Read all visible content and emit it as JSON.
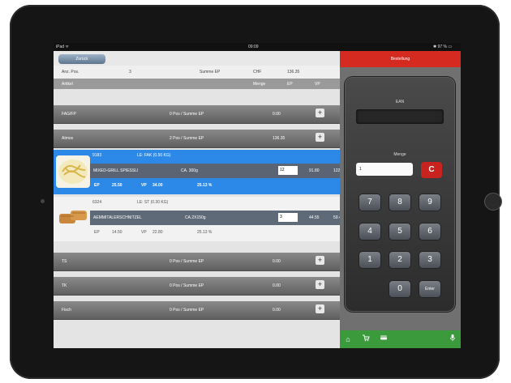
{
  "statusbar": {
    "carrier": "iPad ᯤ",
    "time": "09:09",
    "battery": "✱ 97 % ▭"
  },
  "header": {
    "back_label": "Zurück",
    "order_title": "Bestellung"
  },
  "info": {
    "pos_label": "Anz. Pos.",
    "pos_value": "3",
    "sum_label": "Summe EP",
    "currency": "CHF",
    "sum_value": "136.35"
  },
  "columns": {
    "article": "Artikel",
    "qty": "Menge",
    "ep": "EP",
    "vp": "VP"
  },
  "groups": [
    {
      "name": "FAG/FP",
      "summary": "0 Pos / Summe EP",
      "value": "0.00"
    },
    {
      "name": "Atmos",
      "summary": "2 Pos / Summe EP",
      "value": "136.35"
    },
    {
      "name": "TS",
      "summary": "0 Pos / Summe EP",
      "value": "0.00"
    },
    {
      "name": "TK",
      "summary": "0 Pos / Summe EP",
      "value": "0.00"
    },
    {
      "name": "Fisch",
      "summary": "0 Pos / Summe EP",
      "value": "0.00"
    }
  ],
  "items": [
    {
      "code": "9183",
      "unit": "LE: FAK (0.50 KG)",
      "name": "MIXED-GRILL SPIESSLI",
      "size": "CA. 300g",
      "qty": "12",
      "ep_total": "91.80",
      "vp_total": "122.40",
      "ep_label": "EP",
      "ep": "25.50",
      "vp_label": "VP",
      "vp": "34.00",
      "margin": "25.13 %"
    },
    {
      "code": "6324",
      "unit": "LE: ST (0.30 KG)",
      "name": "AEMMITALERSCHNITZEL",
      "size": "CA.2X150g",
      "qty": "3",
      "ep_total": "44.55",
      "vp_total": "59.40",
      "ep_label": "EP",
      "ep": "14.50",
      "vp_label": "VP",
      "vp": "22.80",
      "margin": "25.13 %"
    }
  ],
  "keypad": {
    "ean_label": "EAN",
    "menge_label": "Menge",
    "menge_value": "1",
    "clear": "C",
    "keys": [
      "7",
      "8",
      "9",
      "4",
      "5",
      "6",
      "1",
      "2",
      "3",
      "0"
    ],
    "enter": "Enter"
  },
  "icons": {
    "home": "home-icon",
    "cart": "cart-icon",
    "card": "card-icon",
    "mic": "microphone-icon",
    "plus": "plus-icon",
    "transfer": "transfer-icon"
  }
}
